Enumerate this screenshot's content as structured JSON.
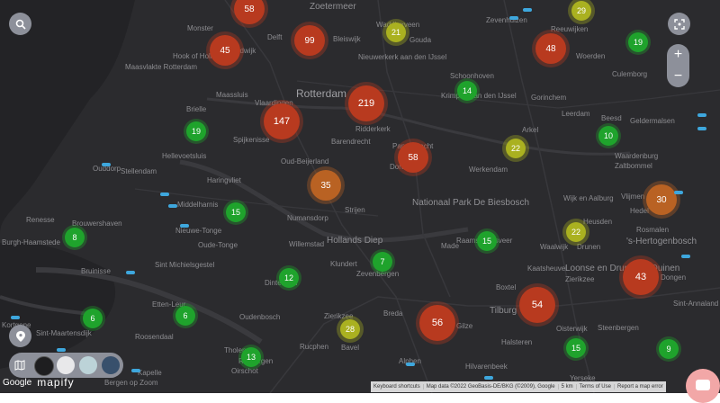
{
  "places": [
    {
      "label": "Zoetermeer",
      "class": "region"
    },
    {
      "label": "Monster",
      "class": ""
    },
    {
      "label": "Delft",
      "class": ""
    },
    {
      "label": "Bleiswijk",
      "class": ""
    },
    {
      "label": "Waddinxveen",
      "class": ""
    },
    {
      "label": "Gouda",
      "class": ""
    },
    {
      "label": "Zevenhuizen",
      "class": ""
    },
    {
      "label": "Reeuwijken",
      "class": ""
    },
    {
      "label": "Naaldwijk",
      "class": ""
    },
    {
      "label": "Hook of Holland",
      "class": ""
    },
    {
      "label": "Maasvlakte Rotterdam",
      "class": ""
    },
    {
      "label": "Nieuwerkerk aan den IJssel",
      "class": ""
    },
    {
      "label": "Woerden",
      "class": ""
    },
    {
      "label": "Schoonhoven",
      "class": ""
    },
    {
      "label": "Culemborg",
      "class": ""
    },
    {
      "label": "Rotterdam",
      "class": "major"
    },
    {
      "label": "Maassluis",
      "class": ""
    },
    {
      "label": "Vlaardingen",
      "class": ""
    },
    {
      "label": "Krimpen aan den IJssel",
      "class": ""
    },
    {
      "label": "Gorinchem",
      "class": ""
    },
    {
      "label": "Brielle",
      "class": ""
    },
    {
      "label": "Ridderkerk",
      "class": ""
    },
    {
      "label": "Arkel",
      "class": ""
    },
    {
      "label": "Leerdam",
      "class": ""
    },
    {
      "label": "Beesd",
      "class": ""
    },
    {
      "label": "Geldermalsen",
      "class": ""
    },
    {
      "label": "Spijkenisse",
      "class": ""
    },
    {
      "label": "Barendrecht",
      "class": ""
    },
    {
      "label": "Papendrecht",
      "class": ""
    },
    {
      "label": "Dordrecht",
      "class": ""
    },
    {
      "label": "Hellevoetsluis",
      "class": ""
    },
    {
      "label": "Oud-Beijerland",
      "class": ""
    },
    {
      "label": "Werkendam",
      "class": ""
    },
    {
      "label": "Zaltbommel",
      "class": ""
    },
    {
      "label": "Waardenburg",
      "class": ""
    },
    {
      "label": "Ouddorp",
      "class": ""
    },
    {
      "label": "Stellendam",
      "class": ""
    },
    {
      "label": "Haringvliet",
      "class": ""
    },
    {
      "label": "Nationaal Park De Biesbosch",
      "class": "region"
    },
    {
      "label": "Vlijmen",
      "class": ""
    },
    {
      "label": "Wijk en Aalburg",
      "class": ""
    },
    {
      "label": "Hedel",
      "class": ""
    },
    {
      "label": "Middelharnis",
      "class": ""
    },
    {
      "label": "Numansdorp",
      "class": ""
    },
    {
      "label": "Strijen",
      "class": ""
    },
    {
      "label": "Heusden",
      "class": ""
    },
    {
      "label": "Dinteloord",
      "class": ""
    },
    {
      "label": "Renesse",
      "class": ""
    },
    {
      "label": "Brouwershaven",
      "class": ""
    },
    {
      "label": "Nieuwe-Tonge",
      "class": ""
    },
    {
      "label": "Willemstad",
      "class": ""
    },
    {
      "label": "Hollands Diep",
      "class": "region"
    },
    {
      "label": "Made",
      "class": ""
    },
    {
      "label": "Waalwijk",
      "class": ""
    },
    {
      "label": "Drunen",
      "class": ""
    },
    {
      "label": "Rosmalen",
      "class": ""
    },
    {
      "label": "'s-Hertogenbosch",
      "class": "region"
    },
    {
      "label": "Burgh-Haamstede",
      "class": ""
    },
    {
      "label": "Oude-Tonge",
      "class": ""
    },
    {
      "label": "Klundert",
      "class": ""
    },
    {
      "label": "Zevenbergen",
      "class": ""
    },
    {
      "label": "Raamsdonksveer",
      "class": ""
    },
    {
      "label": "Kaatsheuvel",
      "class": ""
    },
    {
      "label": "Loonse en Drunense Duinen",
      "class": "region"
    },
    {
      "label": "Zierikzee",
      "class": ""
    },
    {
      "label": "Bruinisse",
      "class": ""
    },
    {
      "label": "Sint Michielsgestel",
      "class": ""
    },
    {
      "label": "Dongen",
      "class": ""
    },
    {
      "label": "Boxtel",
      "class": ""
    },
    {
      "label": "Sint-Annaland",
      "class": ""
    },
    {
      "label": "Etten-Leur",
      "class": ""
    },
    {
      "label": "Breda",
      "class": ""
    },
    {
      "label": "Rijen",
      "class": ""
    },
    {
      "label": "Tilburg",
      "class": "region"
    },
    {
      "label": "Oisterwijk",
      "class": ""
    },
    {
      "label": "Steenbergen",
      "class": ""
    },
    {
      "label": "Oudenbosch",
      "class": ""
    },
    {
      "label": "Zierikzee",
      "class": ""
    },
    {
      "label": "Kortgene",
      "class": ""
    },
    {
      "label": "Sint-Maartensdijk",
      "class": ""
    },
    {
      "label": "Roosendaal",
      "class": ""
    },
    {
      "label": "Rucphen",
      "class": ""
    },
    {
      "label": "Bavel",
      "class": ""
    },
    {
      "label": "Gilze",
      "class": ""
    },
    {
      "label": "Halsteren",
      "class": ""
    },
    {
      "label": "Tholen",
      "class": ""
    },
    {
      "label": "Rijsbergen",
      "class": ""
    },
    {
      "label": "Alphen",
      "class": ""
    },
    {
      "label": "Hilvarenbeek",
      "class": ""
    },
    {
      "label": "Yerseke",
      "class": ""
    },
    {
      "label": "Kapelle",
      "class": ""
    },
    {
      "label": "Bergen op Zoom",
      "class": ""
    },
    {
      "label": "Oirschot",
      "class": ""
    }
  ],
  "clusters": [
    {
      "count": "58",
      "color": "red",
      "size": "m"
    },
    {
      "count": "29",
      "color": "olive",
      "size": "s"
    },
    {
      "count": "99",
      "color": "red",
      "size": "m"
    },
    {
      "count": "21",
      "color": "olive",
      "size": "s"
    },
    {
      "count": "45",
      "color": "red",
      "size": "m"
    },
    {
      "count": "48",
      "color": "red",
      "size": "m"
    },
    {
      "count": "19",
      "color": "green",
      "size": "s"
    },
    {
      "count": "14",
      "color": "green",
      "size": "s"
    },
    {
      "count": "219",
      "color": "red",
      "size": "l"
    },
    {
      "count": "147",
      "color": "red",
      "size": "l"
    },
    {
      "count": "19",
      "color": "green",
      "size": "s"
    },
    {
      "count": "10",
      "color": "green",
      "size": "s"
    },
    {
      "count": "22",
      "color": "olive",
      "size": "s"
    },
    {
      "count": "58",
      "color": "red",
      "size": "m"
    },
    {
      "count": "35",
      "color": "orange",
      "size": "m"
    },
    {
      "count": "30",
      "color": "orange",
      "size": "m"
    },
    {
      "count": "15",
      "color": "green",
      "size": "s"
    },
    {
      "count": "22",
      "color": "olive",
      "size": "s"
    },
    {
      "count": "8",
      "color": "green",
      "size": "s"
    },
    {
      "count": "15",
      "color": "green",
      "size": "s"
    },
    {
      "count": "7",
      "color": "green",
      "size": "s"
    },
    {
      "count": "43",
      "color": "red",
      "size": "l"
    },
    {
      "count": "12",
      "color": "green",
      "size": "s"
    },
    {
      "count": "54",
      "color": "red",
      "size": "l"
    },
    {
      "count": "6",
      "color": "green",
      "size": "s"
    },
    {
      "count": "6",
      "color": "green",
      "size": "s"
    },
    {
      "count": "56",
      "color": "red",
      "size": "l"
    },
    {
      "count": "28",
      "color": "olive",
      "size": "s"
    },
    {
      "count": "15",
      "color": "green",
      "size": "s"
    },
    {
      "count": "9",
      "color": "green",
      "size": "s"
    },
    {
      "count": "13",
      "color": "green",
      "size": "s"
    }
  ],
  "controls": {
    "zoom_in": "+",
    "zoom_out": "−",
    "search_icon": "search-icon",
    "fullscreen_icon": "fullscreen-icon",
    "pin_icon": "location-pin-icon",
    "map_style_icon": "map-icon"
  },
  "brand": {
    "google": "Google",
    "mapify": "mapify"
  },
  "attribution": {
    "shortcuts": "Keyboard shortcuts",
    "data": "Map data ©2022 GeoBasis-DE/BKG (©2009), Google",
    "scale": "5 km",
    "terms": "Terms of Use",
    "report": "Report a map error"
  },
  "colors": {
    "green": "#1fa32c",
    "olive": "#aab120",
    "orange": "#b96223",
    "red": "#b83a1f",
    "accent_button": "#8d909a",
    "chat": "#f2a7a7"
  }
}
